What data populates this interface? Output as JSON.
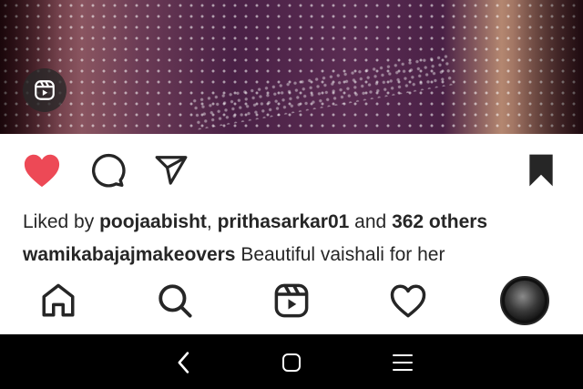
{
  "post": {
    "media_type_icon": "reels-icon",
    "colors": {
      "like_active": "#ed4956",
      "text": "#262626"
    }
  },
  "actions": {
    "like_icon": "heart-filled-icon",
    "comment_icon": "comment-icon",
    "share_icon": "paper-plane-icon",
    "save_icon": "bookmark-filled-icon"
  },
  "likes": {
    "prefix": "Liked by ",
    "user1": "poojaabisht",
    "separator": ", ",
    "user2": "prithasarkar01",
    "connector": " and ",
    "others": "362 others"
  },
  "caption": {
    "username": "wamikabajajmakeovers",
    "text": " Beautiful vaishali for her"
  },
  "tabbar": {
    "items": [
      {
        "name": "home",
        "icon": "home-icon"
      },
      {
        "name": "search",
        "icon": "search-icon"
      },
      {
        "name": "reels",
        "icon": "reels-icon"
      },
      {
        "name": "activity",
        "icon": "heart-outline-icon"
      },
      {
        "name": "profile",
        "icon": "avatar"
      }
    ]
  },
  "system_nav": {
    "back_icon": "back-chevron-icon",
    "home_icon": "home-square-icon",
    "recents_icon": "recents-lines-icon"
  }
}
